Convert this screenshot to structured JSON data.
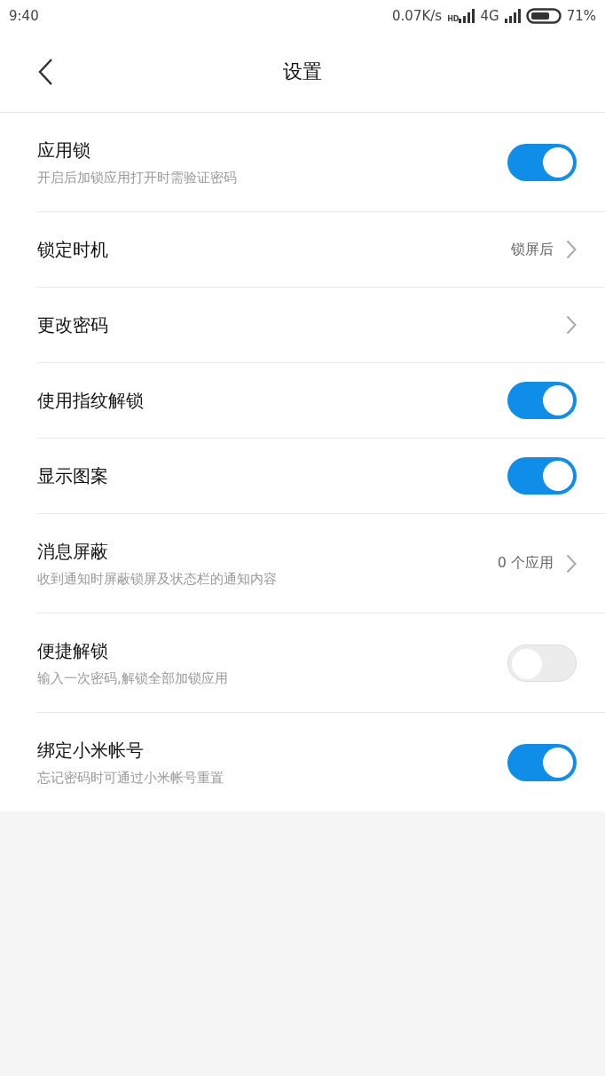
{
  "status_bar": {
    "time": "9:40",
    "net_speed": "0.07K/s",
    "hd_label": "HD",
    "network": "4G",
    "battery": "71%"
  },
  "header": {
    "title": "设置"
  },
  "settings": [
    {
      "kind": "toggle",
      "title": "应用锁",
      "subtitle": "开启后加锁应用打开时需验证密码",
      "on": true
    },
    {
      "kind": "link",
      "title": "锁定时机",
      "value": "锁屏后"
    },
    {
      "kind": "link",
      "title": "更改密码"
    },
    {
      "kind": "toggle",
      "title": "使用指纹解锁",
      "on": true
    },
    {
      "kind": "toggle",
      "title": "显示图案",
      "on": true
    },
    {
      "kind": "link",
      "title": "消息屏蔽",
      "subtitle": "收到通知时屏蔽锁屏及状态栏的通知内容",
      "value": "0 个应用"
    },
    {
      "kind": "toggle",
      "title": "便捷解锁",
      "subtitle": "输入一次密码,解锁全部加锁应用",
      "on": false
    },
    {
      "kind": "toggle",
      "title": "绑定小米帐号",
      "subtitle": "忘记密码时可通过小米帐号重置",
      "on": true
    }
  ]
}
